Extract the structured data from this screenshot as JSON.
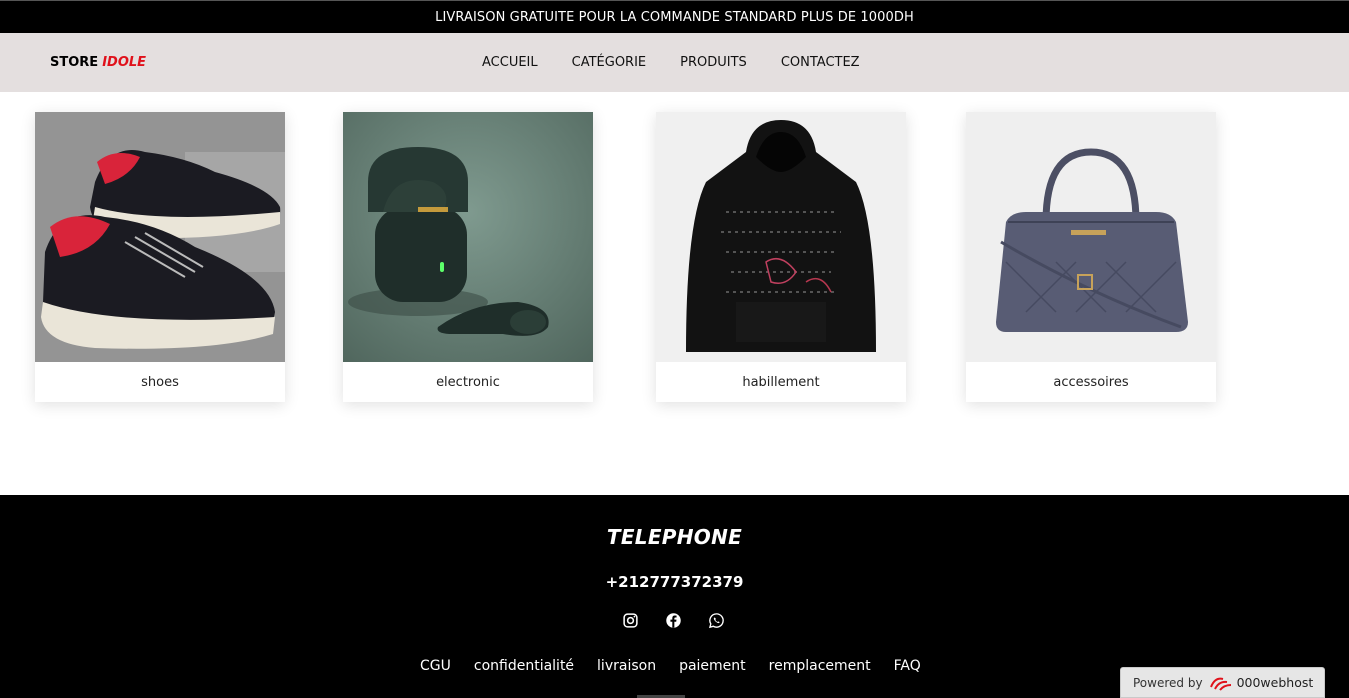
{
  "announcement": "LIVRAISON GRATUITE POUR LA COMMANDE STANDARD PLUS DE 1000DH",
  "logo": {
    "main": "STORE",
    "accent": "IDOLE"
  },
  "nav": [
    "ACCUEIL",
    "CATÉGORIE",
    "PRODUITS",
    "CONTACTEZ"
  ],
  "categories": [
    {
      "label": "shoes",
      "image": "sneakers-photo"
    },
    {
      "label": "electronic",
      "image": "earbuds-photo"
    },
    {
      "label": "habillement",
      "image": "hoodie-photo"
    },
    {
      "label": "accessoires",
      "image": "handbag-photo"
    }
  ],
  "footer": {
    "title": "TELEPHONE",
    "phone": "+212777372379",
    "socials": [
      "instagram-icon",
      "facebook-icon",
      "whatsapp-icon"
    ],
    "links": [
      "CGU",
      "confidentialité",
      "livraison",
      "paiement",
      "remplacement",
      "FAQ"
    ]
  },
  "hosting_badge": {
    "prefix": "Powered by",
    "brand": "000webhost"
  },
  "colors": {
    "accent": "#e0111b",
    "navbar_bg": "#e4dfdf",
    "footer_bg": "#000000"
  }
}
